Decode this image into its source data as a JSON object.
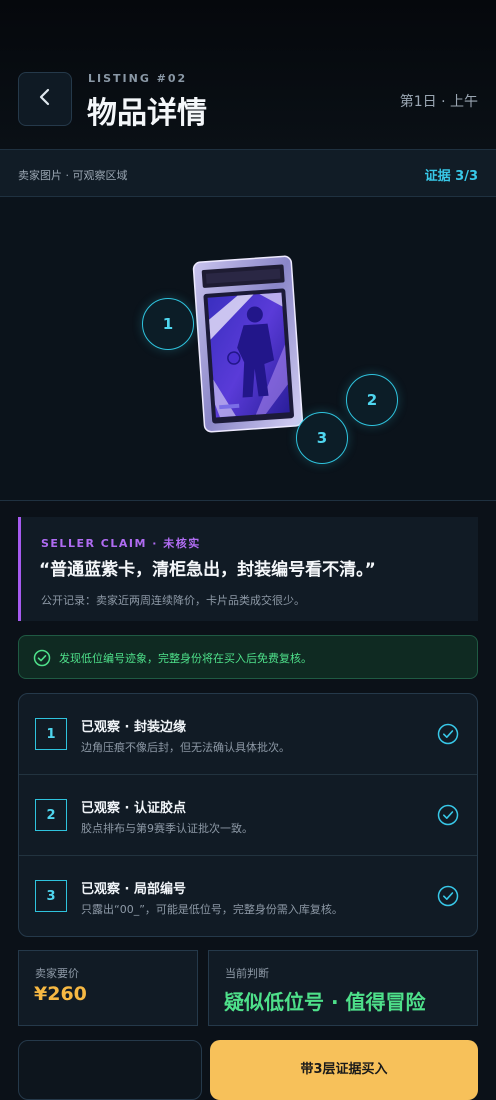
{
  "header": {
    "eyebrow": "LISTING #02",
    "title": "物品详情",
    "day_info": "第1日 · 上午"
  },
  "evidence": {
    "label": "卖家图片 · 可观察区域",
    "count": "证据 3/3"
  },
  "markers": [
    "1",
    "2",
    "3"
  ],
  "claim": {
    "kicker": "SELLER CLAIM · 未核实",
    "quote": "“普通蓝紫卡，清柜急出，封装编号看不清。”",
    "note": "公开记录：卖家近两周连续降价，卡片品类成交很少。"
  },
  "alert": {
    "text": "发现低位编号迹象，完整身份将在买入后免费复核。"
  },
  "observations": [
    {
      "num": "1",
      "title": "已观察 · 封装边缘",
      "desc": "边角压痕不像后封，但无法确认具体批次。"
    },
    {
      "num": "2",
      "title": "已观察 · 认证胶点",
      "desc": "胶点排布与第9赛季认证批次一致。"
    },
    {
      "num": "3",
      "title": "已观察 · 局部编号",
      "desc": "只露出“00_”，可能是低位号，完整身份需入库复核。"
    }
  ],
  "price": {
    "label": "卖家要价",
    "value": "¥260"
  },
  "judgement": {
    "label": "当前判断",
    "value": "疑似低位号 · 值得冒险"
  },
  "actions": {
    "primary": "带3层证据买入",
    "secondary": ""
  },
  "colors": {
    "accent_cyan": "#2fc3dd",
    "accent_purple": "#a65bf0",
    "success_green": "#4ee08a",
    "price_gold": "#f6b843",
    "button_yellow": "#f7c15a"
  }
}
